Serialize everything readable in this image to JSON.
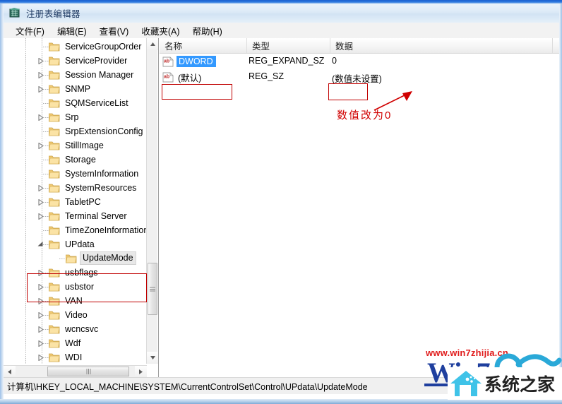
{
  "window": {
    "title": "注册表编辑器",
    "icon": "registry-editor-icon"
  },
  "menu": {
    "items": [
      {
        "label": "文件(F)"
      },
      {
        "label": "编辑(E)"
      },
      {
        "label": "查看(V)"
      },
      {
        "label": "收藏夹(A)"
      },
      {
        "label": "帮助(H)"
      }
    ]
  },
  "tree": {
    "items": [
      {
        "label": "ServiceGroupOrder",
        "depth": 1,
        "expander": "none",
        "selected": false
      },
      {
        "label": "ServiceProvider",
        "depth": 1,
        "expander": "collapsed",
        "selected": false
      },
      {
        "label": "Session Manager",
        "depth": 1,
        "expander": "collapsed",
        "selected": false
      },
      {
        "label": "SNMP",
        "depth": 1,
        "expander": "collapsed",
        "selected": false
      },
      {
        "label": "SQMServiceList",
        "depth": 1,
        "expander": "none",
        "selected": false
      },
      {
        "label": "Srp",
        "depth": 1,
        "expander": "collapsed",
        "selected": false
      },
      {
        "label": "SrpExtensionConfig",
        "depth": 1,
        "expander": "none",
        "selected": false
      },
      {
        "label": "StillImage",
        "depth": 1,
        "expander": "collapsed",
        "selected": false
      },
      {
        "label": "Storage",
        "depth": 1,
        "expander": "none",
        "selected": false
      },
      {
        "label": "SystemInformation",
        "depth": 1,
        "expander": "none",
        "selected": false
      },
      {
        "label": "SystemResources",
        "depth": 1,
        "expander": "collapsed",
        "selected": false
      },
      {
        "label": "TabletPC",
        "depth": 1,
        "expander": "collapsed",
        "selected": false
      },
      {
        "label": "Terminal Server",
        "depth": 1,
        "expander": "collapsed",
        "selected": false
      },
      {
        "label": "TimeZoneInformation",
        "depth": 1,
        "expander": "none",
        "selected": false
      },
      {
        "label": "UPdata",
        "depth": 1,
        "expander": "expanded",
        "selected": false
      },
      {
        "label": "UpdateMode",
        "depth": 2,
        "expander": "none",
        "selected": true
      },
      {
        "label": "usbflags",
        "depth": 1,
        "expander": "collapsed",
        "selected": false
      },
      {
        "label": "usbstor",
        "depth": 1,
        "expander": "collapsed",
        "selected": false
      },
      {
        "label": "VAN",
        "depth": 1,
        "expander": "collapsed",
        "selected": false
      },
      {
        "label": "Video",
        "depth": 1,
        "expander": "collapsed",
        "selected": false
      },
      {
        "label": "wcncsvc",
        "depth": 1,
        "expander": "collapsed",
        "selected": false
      },
      {
        "label": "Wdf",
        "depth": 1,
        "expander": "collapsed",
        "selected": false
      },
      {
        "label": "WDI",
        "depth": 1,
        "expander": "collapsed",
        "selected": false
      }
    ]
  },
  "list": {
    "columns": [
      {
        "label": "名称"
      },
      {
        "label": "类型"
      },
      {
        "label": "数据"
      },
      {
        "label": ""
      }
    ],
    "rows": [
      {
        "name": "(默认)",
        "type": "REG_SZ",
        "data": "(数值未设置)",
        "selected": false,
        "icon": "string-value-icon"
      },
      {
        "name": "DWORD",
        "type": "REG_EXPAND_SZ",
        "data": "0",
        "selected": true,
        "icon": "string-value-icon"
      }
    ]
  },
  "annotation": {
    "text": "数值改为0",
    "color": "#d00000"
  },
  "status": {
    "path": "计算机\\HKEY_LOCAL_MACHINE\\SYSTEM\\CurrentControlSet\\Control\\UPdata\\UpdateMode"
  },
  "watermark": {
    "url": "www.win7zhijia.cn",
    "brand": "Win7",
    "logo_text": "系统之家",
    "url_color": "#e01b1b",
    "brand_color": "#1f3f9e"
  }
}
